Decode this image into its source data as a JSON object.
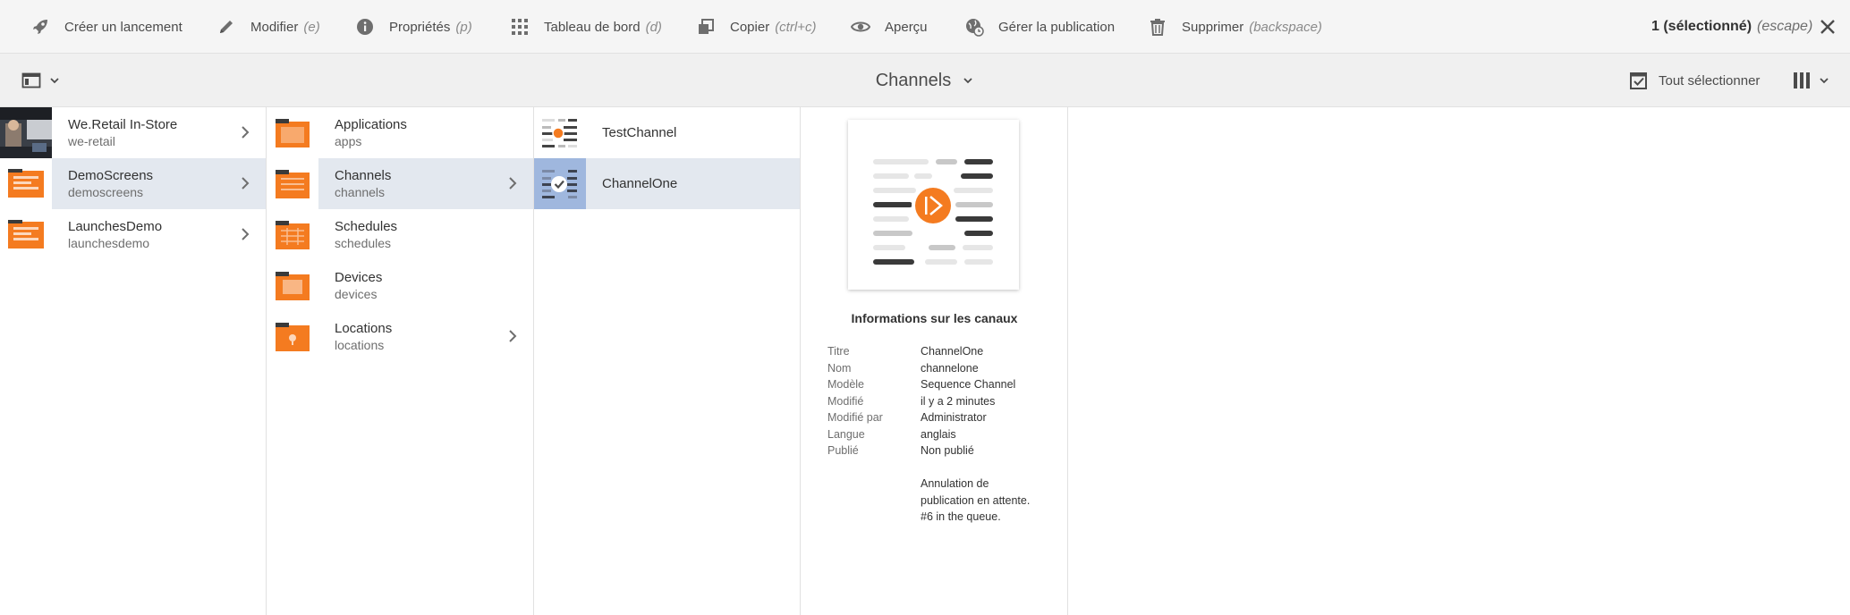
{
  "toolbar": {
    "actions": [
      {
        "label": "Créer un lancement",
        "shortcut": "",
        "icon": "rocket-icon"
      },
      {
        "label": "Modifier",
        "shortcut": "(e)",
        "icon": "pencil-icon"
      },
      {
        "label": "Propriétés",
        "shortcut": "(p)",
        "icon": "info-icon"
      },
      {
        "label": "Tableau de bord",
        "shortcut": "(d)",
        "icon": "grid-icon"
      },
      {
        "label": "Copier",
        "shortcut": "(ctrl+c)",
        "icon": "copy-icon"
      },
      {
        "label": "Aperçu",
        "shortcut": "",
        "icon": "eye-icon"
      },
      {
        "label": "Gérer la publication",
        "shortcut": "",
        "icon": "globe-clock-icon"
      },
      {
        "label": "Supprimer",
        "shortcut": "(backspace)",
        "icon": "trash-icon"
      }
    ],
    "selection_count": "1 (sélectionné)",
    "selection_shortcut": "(escape)"
  },
  "header": {
    "title": "Channels",
    "select_all": "Tout sélectionner"
  },
  "columns": {
    "col1": [
      {
        "title": "We.Retail In-Store",
        "sub": "we-retail",
        "has_children": true,
        "state": ""
      },
      {
        "title": "DemoScreens",
        "sub": "demoscreens",
        "has_children": true,
        "state": "active"
      },
      {
        "title": "LaunchesDemo",
        "sub": "launchesdemo",
        "has_children": true,
        "state": ""
      }
    ],
    "col2": [
      {
        "title": "Applications",
        "sub": "apps",
        "has_children": false,
        "state": ""
      },
      {
        "title": "Channels",
        "sub": "channels",
        "has_children": true,
        "state": "active"
      },
      {
        "title": "Schedules",
        "sub": "schedules",
        "has_children": false,
        "state": ""
      },
      {
        "title": "Devices",
        "sub": "devices",
        "has_children": false,
        "state": ""
      },
      {
        "title": "Locations",
        "sub": "locations",
        "has_children": true,
        "state": ""
      }
    ],
    "col3": [
      {
        "title": "TestChannel",
        "state": ""
      },
      {
        "title": "ChannelOne",
        "state": "selected"
      }
    ]
  },
  "preview": {
    "heading": "Informations sur les canaux",
    "fields": [
      {
        "key": "Titre",
        "value": "ChannelOne"
      },
      {
        "key": "Nom",
        "value": "channelone"
      },
      {
        "key": "Modèle",
        "value": "Sequence Channel"
      },
      {
        "key": "Modifié",
        "value": "il y a 2 minutes"
      },
      {
        "key": "Modifié par",
        "value": "Administrator"
      },
      {
        "key": "Langue",
        "value": "anglais"
      },
      {
        "key": "Publié",
        "value": "Non publié"
      }
    ],
    "note_lines": [
      "Annulation de",
      "publication en attente.",
      "#6 in the queue."
    ]
  },
  "colors": {
    "accent_orange": "#f47b20",
    "selection_blue": "#9fb7de",
    "row_highlight": "#e3e8ef"
  }
}
